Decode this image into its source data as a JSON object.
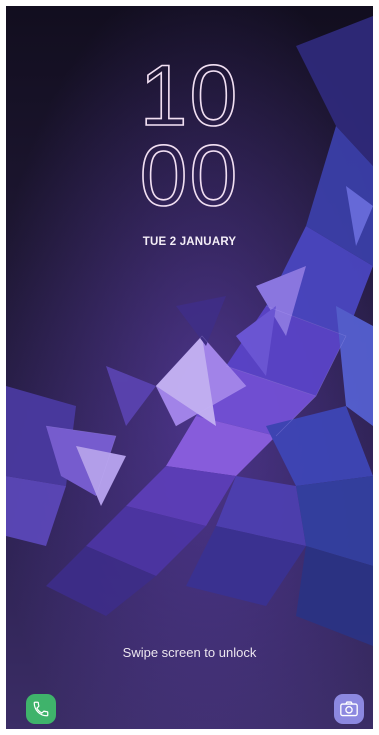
{
  "lockscreen": {
    "time_hours": "10",
    "time_minutes": "00",
    "date": "TUE 2 JANUARY",
    "unlock_hint": "Swipe screen to unlock"
  },
  "shortcuts": {
    "left_icon": "phone-icon",
    "right_icon": "camera-icon",
    "phone_color": "#3fb36b",
    "camera_color": "#8c88e0"
  },
  "wallpaper": {
    "base_color": "#1c1430",
    "accent_color": "#7b4fd0"
  }
}
